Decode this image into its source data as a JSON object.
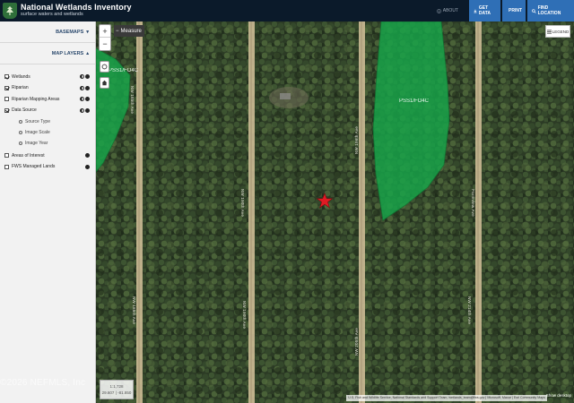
{
  "header": {
    "title": "National Wetlands Inventory",
    "subtitle": "surface waters and wetlands",
    "about": "ABOUT",
    "buttons": {
      "get_data": "GET DATA",
      "print": "PRINT",
      "find_location": "FIND LOCATION"
    }
  },
  "sidebar": {
    "basemaps": "BASEMAPS",
    "map_layers": "MAP LAYERS",
    "layers": [
      {
        "label": "Wetlands",
        "checked": true
      },
      {
        "label": "Riparian",
        "checked": true
      },
      {
        "label": "Riparian Mapping Areas",
        "checked": false
      },
      {
        "label": "Data Source",
        "checked": true
      }
    ],
    "data_source_options": [
      "Source Type",
      "Image Scale",
      "Image Year"
    ],
    "extra_layers": [
      {
        "label": "Areas of Interest",
        "checked": false
      },
      {
        "label": "FWS Managed Lands",
        "checked": false
      }
    ]
  },
  "map": {
    "zoom_in": "+",
    "zoom_out": "−",
    "measure": "Measure",
    "legend": "LEGEND",
    "polygon_labels": [
      "PSS1/FO4C",
      "PSS1/FO4C"
    ],
    "road_labels": [
      "NW 185th Ave",
      "NW 190th Ave",
      "NW 196th Ave",
      "NW 205th Ave",
      "Farmview Ave",
      "NW 214th Ave"
    ],
    "scale": {
      "ratio": "1:1,728",
      "coords": "29.607 | -81.850"
    },
    "attribution": "U.S. Fish and Wildlife Service, National Standards and Support Team, wetlands_team@fws.gov | Microsoft, Maxar | Esri Community Maps",
    "show_desktop": "Show desktop",
    "watermark": "©2026 NEFMLS, Inc",
    "colors": {
      "wetland_polygon": "#17a64a",
      "marker": "#e01b24",
      "header_bg": "#0b1a2a",
      "button_bg": "#2f6fb6"
    }
  }
}
